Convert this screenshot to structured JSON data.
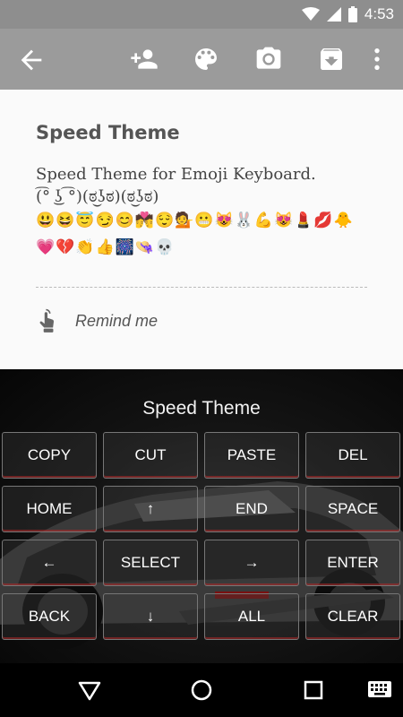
{
  "status": {
    "time": "4:53"
  },
  "note": {
    "title": "Speed Theme",
    "body_line1": "Speed Theme for  Emoji Keyboard.",
    "body_line2": "(͡° ͜ʖ ͡°)(ಠ͜ʖಠ)(ಠ͜ʖಠ)",
    "emoji_row1": "😃😆😇😏😊💏😌💁😬😻🐰💪😻💄💋🐥",
    "emoji_row2": "💗💔👏👍🎆👒💀",
    "remind_label": "Remind me"
  },
  "keyboard": {
    "title": "Speed Theme",
    "keys": {
      "copy": "COPY",
      "cut": "CUT",
      "paste": "PASTE",
      "del": "DEL",
      "home": "HOME",
      "up": "↑",
      "end": "END",
      "space": "SPACE",
      "left": "←",
      "select": "SELECT",
      "right": "→",
      "enter": "ENTER",
      "back": "BACK",
      "down": "↓",
      "all": "ALL",
      "clear": "CLEAR"
    }
  },
  "icons": {
    "wifi": "wifi-icon",
    "signal": "signal-icon",
    "battery": "battery-icon",
    "back": "back-arrow-icon",
    "add_person": "add-person-icon",
    "palette": "palette-icon",
    "camera": "camera-icon",
    "archive": "archive-icon",
    "more": "more-vert-icon",
    "remind": "touch-hand-icon"
  }
}
